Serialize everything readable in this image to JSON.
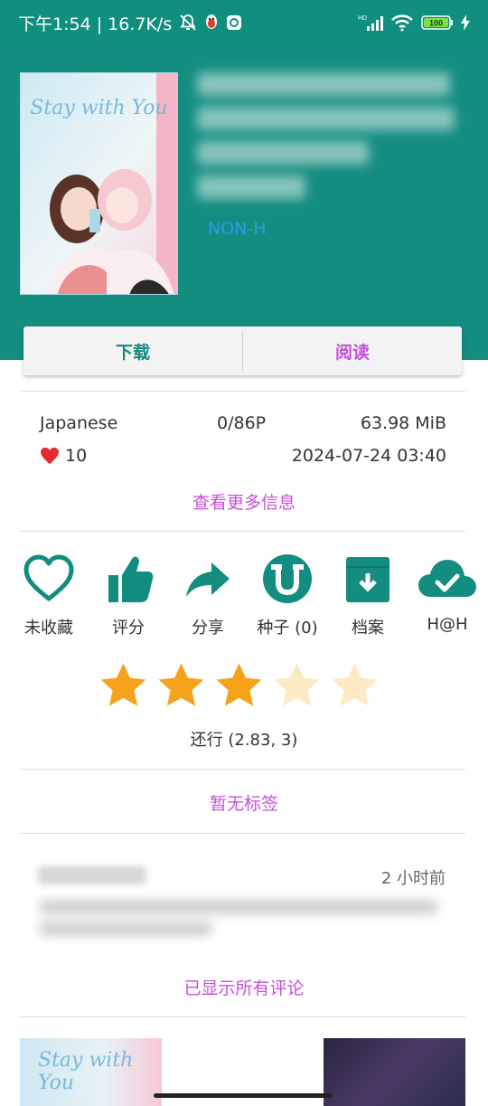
{
  "status_bar": {
    "time_speed": "下午1:54 | 16.7K/s",
    "network_badge": "HD",
    "battery": "100",
    "icons": [
      "mute-bell-icon",
      "qq-penguin-icon",
      "app-notification-icon",
      "signal-icon",
      "wifi-icon",
      "battery-icon",
      "charging-icon"
    ]
  },
  "gallery": {
    "cover_text": "Stay with You",
    "category": "NON-H"
  },
  "actions": {
    "download": "下载",
    "read": "阅读"
  },
  "info": {
    "language": "Japanese",
    "pages": "0/86P",
    "size": "63.98 MiB",
    "favorites": "10",
    "posted": "2024-07-24 03:40",
    "more_info": "查看更多信息"
  },
  "icon_row": [
    {
      "label": "未收藏",
      "icon": "heart-outline-icon"
    },
    {
      "label": "评分",
      "icon": "thumbs-up-icon"
    },
    {
      "label": "分享",
      "icon": "share-arrow-icon"
    },
    {
      "label": "种子 (0)",
      "icon": "torrent-icon"
    },
    {
      "label": "档案",
      "icon": "archive-icon"
    },
    {
      "label": "H@H",
      "icon": "cloud-check-icon"
    }
  ],
  "rating": {
    "stars_filled": 3,
    "stars_total": 5,
    "text": "还行 (2.83, 3)"
  },
  "tags": {
    "empty_text": "暂无标签"
  },
  "comments": {
    "time": "2 小时前",
    "show_all": "已显示所有评论"
  },
  "colors": {
    "primary": "#138d7f",
    "accent": "#c64fdc",
    "link_blue": "#2b9bea",
    "star": "#f7a21b",
    "star_empty": "#fde9c4"
  }
}
